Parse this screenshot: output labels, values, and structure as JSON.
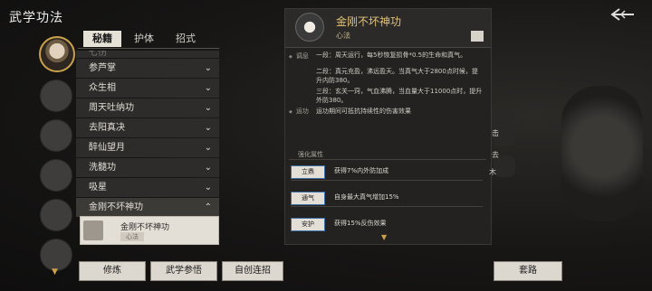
{
  "header": {
    "title": "武学功法"
  },
  "tabs": [
    {
      "label": "秘籍"
    },
    {
      "label": "护体"
    },
    {
      "label": "招式"
    }
  ],
  "list": {
    "partial": "七伤",
    "items": [
      {
        "label": "参芦掌"
      },
      {
        "label": "众生相"
      },
      {
        "label": "周天吐纳功"
      },
      {
        "label": "去阳真决"
      },
      {
        "label": "醉仙望月"
      },
      {
        "label": "洗髓功"
      },
      {
        "label": "吸星"
      }
    ],
    "open_item": {
      "label": "金刚不坏神功"
    },
    "sub_item": {
      "name": "金刚不坏神功",
      "tag": "心法"
    }
  },
  "detail": {
    "name": "金刚不坏神功",
    "type": "心法",
    "desc_label": "调息",
    "desc_lines": [
      "一段：周天运行，每5秒恢复损骨*0.5的生命和真气。",
      "二段：真元充盈，沸远盈天。当真气大于2800点时候，提升内防380。",
      "三段：玄关一窍，气血沸腾，当血量大于11000点时，提升外防380。"
    ],
    "move_label": "运功",
    "move_text": "运功期间可抵抗持续性的伤害效果",
    "section_title": "强化属性",
    "attrs": [
      {
        "chip": "立鼎",
        "text": "获得7%内外防加成"
      },
      {
        "chip": "通气",
        "text": "自身最大真气增加15%"
      },
      {
        "chip": "安护",
        "text": "获得15%反伤效果"
      }
    ]
  },
  "bottom": {
    "b1": "修炼",
    "b2": "武学参悟",
    "b3": "自创连招",
    "b4": "套路"
  },
  "deco": {
    "t1": "击",
    "t2": "去",
    "t3": "木"
  }
}
